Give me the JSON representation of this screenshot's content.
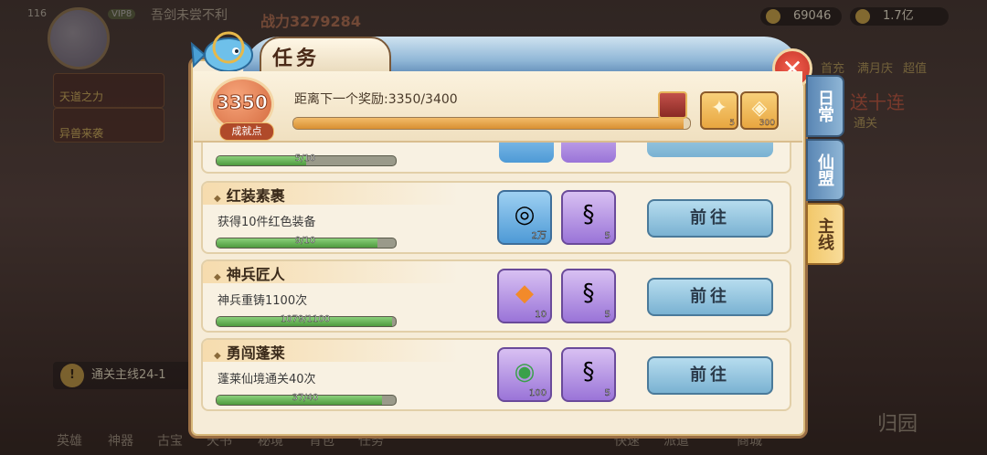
{
  "hud": {
    "level": "116",
    "vip": "VIP8",
    "player_name": "吾剑未尝不利",
    "power_label": "战力",
    "power": "3279284",
    "resource1": "69046",
    "resource2": "1.7亿"
  },
  "side_left": {
    "item1": "天道之力",
    "item2": "异兽来袭"
  },
  "chip": {
    "label": "通关主线24-1"
  },
  "right_buttons": {
    "b1": "首充",
    "b2": "满月庆",
    "b3": "超值",
    "b4": "送十连",
    "b5": "通关"
  },
  "bottom_nav": [
    "英雄",
    "神器",
    "古宝",
    "天书",
    "秘境",
    "背包",
    "任务",
    "快速",
    "派遣",
    "商城",
    "归园"
  ],
  "panel": {
    "title": "任务",
    "close": "✕",
    "badge_value": "3350",
    "badge_label": "成就点",
    "reward_text": "距离下一个奖励:3350/3400",
    "reward_progress": 0.985,
    "top_rewards": [
      {
        "count": "5",
        "glyph": "✦"
      },
      {
        "count": "300",
        "glyph": "◈"
      }
    ]
  },
  "side_tabs": [
    {
      "label": "日常",
      "active": false
    },
    {
      "label": "仙盟",
      "active": false
    },
    {
      "label": "主线",
      "active": true
    }
  ],
  "partial_row": {
    "progress_text": "5/10",
    "progress": 0.5,
    "item2_count": "5"
  },
  "tasks": [
    {
      "title": "红装素裹",
      "desc": "获得10件红色装备",
      "progress_text": "9/10",
      "progress": 0.9,
      "rewards": [
        {
          "style": "blue",
          "glyph": "◎",
          "count": "2万"
        },
        {
          "style": "purple",
          "glyph": "§",
          "count": "5"
        }
      ],
      "button": "前往"
    },
    {
      "title": "神兵匠人",
      "desc": "神兵重铸1100次",
      "progress_text": "1079/1100",
      "progress": 0.981,
      "rewards": [
        {
          "style": "purple",
          "glyph": "◆",
          "count": "10"
        },
        {
          "style": "purple",
          "glyph": "§",
          "count": "5"
        }
      ],
      "button": "前往"
    },
    {
      "title": "勇闯蓬莱",
      "desc": "蓬莱仙境通关40次",
      "progress_text": "37/40",
      "progress": 0.925,
      "rewards": [
        {
          "style": "purple",
          "glyph": "◉",
          "count": "100"
        },
        {
          "style": "purple",
          "glyph": "§",
          "count": "5"
        }
      ],
      "button": "前往"
    }
  ]
}
